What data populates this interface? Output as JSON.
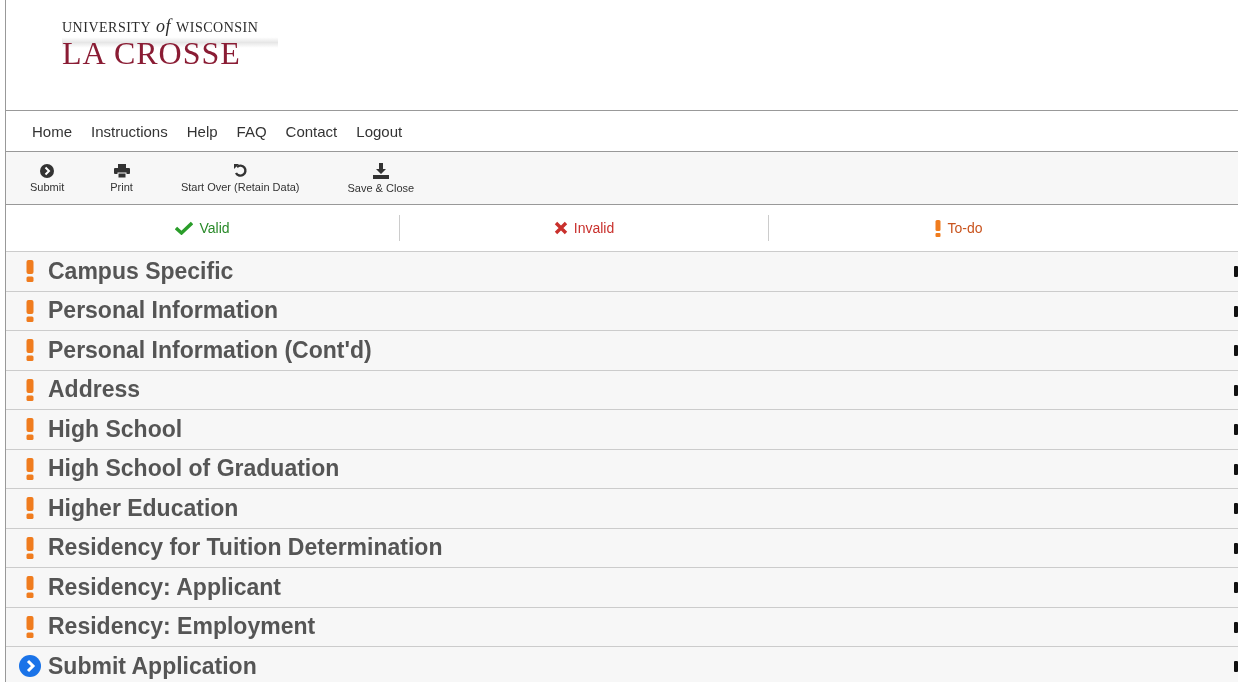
{
  "logo": {
    "line1_left": "UNIVERSITY",
    "line1_mid": "of",
    "line1_right": "WISCONSIN",
    "line2": "LA CROSSE"
  },
  "nav": [
    {
      "label": "Home"
    },
    {
      "label": "Instructions"
    },
    {
      "label": "Help"
    },
    {
      "label": "FAQ"
    },
    {
      "label": "Contact"
    },
    {
      "label": "Logout"
    }
  ],
  "toolbar": [
    {
      "kind": "submit",
      "label": "Submit"
    },
    {
      "kind": "print",
      "label": "Print"
    },
    {
      "kind": "restart",
      "label": "Start Over (Retain Data)"
    },
    {
      "kind": "save",
      "label": "Save & Close"
    }
  ],
  "legend": [
    {
      "kind": "valid",
      "label": "Valid"
    },
    {
      "kind": "invalid",
      "label": "Invalid"
    },
    {
      "kind": "todo",
      "label": "To-do"
    }
  ],
  "sections": [
    {
      "kind": "todo",
      "title": "Campus Specific"
    },
    {
      "kind": "todo",
      "title": "Personal Information"
    },
    {
      "kind": "todo",
      "title": "Personal Information (Cont'd)"
    },
    {
      "kind": "todo",
      "title": "Address"
    },
    {
      "kind": "todo",
      "title": "High School"
    },
    {
      "kind": "todo",
      "title": "High School of Graduation"
    },
    {
      "kind": "todo",
      "title": "Higher Education"
    },
    {
      "kind": "todo",
      "title": "Residency for Tuition Determination"
    },
    {
      "kind": "todo",
      "title": "Residency: Applicant"
    },
    {
      "kind": "todo",
      "title": "Residency: Employment"
    },
    {
      "kind": "submit",
      "title": "Submit Application"
    }
  ]
}
